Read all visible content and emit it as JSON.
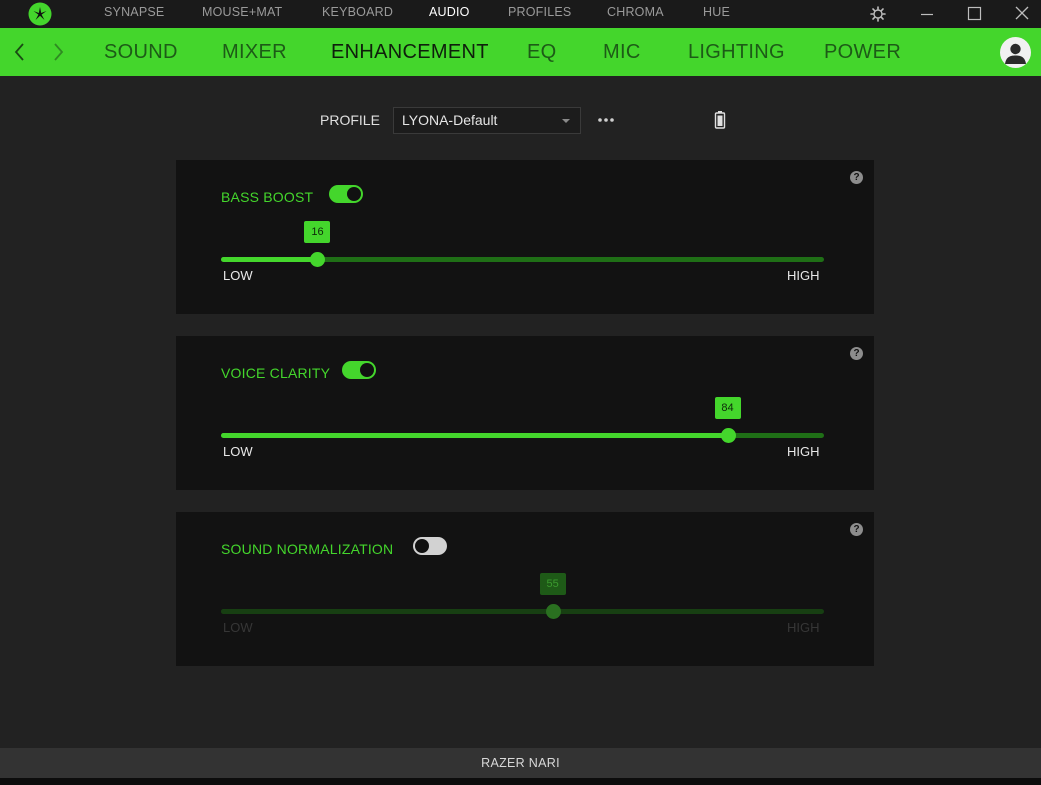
{
  "window": {
    "top_nav": [
      {
        "label": "SYNAPSE",
        "active": false
      },
      {
        "label": "MOUSE+MAT",
        "active": false
      },
      {
        "label": "KEYBOARD",
        "active": false
      },
      {
        "label": "AUDIO",
        "active": true
      },
      {
        "label": "PROFILES",
        "active": false
      },
      {
        "label": "CHROMA",
        "active": false
      },
      {
        "label": "HUE",
        "active": false
      }
    ],
    "controls": [
      "gear-icon",
      "minimize-icon",
      "maximize-icon",
      "close-icon"
    ]
  },
  "sub_nav": {
    "tabs": [
      {
        "label": "SOUND",
        "active": false
      },
      {
        "label": "MIXER",
        "active": false
      },
      {
        "label": "ENHANCEMENT",
        "active": true
      },
      {
        "label": "EQ",
        "active": false
      },
      {
        "label": "MIC",
        "active": false
      },
      {
        "label": "LIGHTING",
        "active": false
      },
      {
        "label": "POWER",
        "active": false
      }
    ]
  },
  "profile": {
    "label": "PROFILE",
    "selected": "LYONA-Default"
  },
  "panels": [
    {
      "title": "BASS BOOST",
      "enabled": true,
      "value": 16,
      "value_label": "16",
      "low_label": "LOW",
      "high_label": "HIGH",
      "help": "?"
    },
    {
      "title": "VOICE CLARITY",
      "enabled": true,
      "value": 84,
      "value_label": "84",
      "low_label": "LOW",
      "high_label": "HIGH",
      "help": "?"
    },
    {
      "title": "SOUND NORMALIZATION",
      "enabled": false,
      "value": 55,
      "value_label": "55",
      "low_label": "LOW",
      "high_label": "HIGH",
      "help": "?"
    }
  ],
  "footer": {
    "device": "RAZER NARI"
  },
  "colors": {
    "accent": "#44d62c",
    "background": "#222222",
    "panel": "#121212"
  }
}
